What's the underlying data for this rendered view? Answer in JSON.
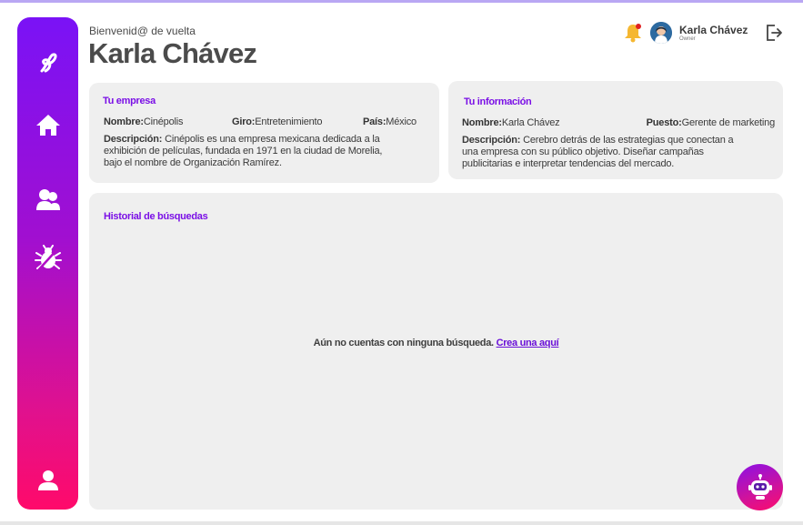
{
  "header": {
    "welcome": "Bienvenid@ de vuelta",
    "title": "Karla Chávez"
  },
  "user": {
    "name": "Karla Chávez",
    "role": "Owner",
    "notifications_indicator": true
  },
  "sidebar": {
    "items": [
      {
        "icon": "logo-icon"
      },
      {
        "icon": "home-icon"
      },
      {
        "icon": "users-icon"
      },
      {
        "icon": "bug-icon"
      },
      {
        "icon": "profile-icon"
      }
    ]
  },
  "company": {
    "title": "Tu empresa",
    "name_label": "Nombre:",
    "name": "Cinépolis",
    "giro_label": "Giro:",
    "giro": "Entretenimiento",
    "pais_label": "País:",
    "pais": "México",
    "desc_label": "Descripción:",
    "desc_line1": " Cinépolis es una empresa mexicana dedicada a la",
    "desc_line2": "exhibición de películas, fundada en 1971 en la ciudad de Morelia,",
    "desc_line3": "bajo el nombre de Organización Ramírez."
  },
  "info": {
    "title": "Tu información",
    "name_label": "Nombre:",
    "name": "Karla Chávez",
    "puesto_label": "Puesto:",
    "puesto": "Gerente de marketing",
    "desc_label": "Descripción:",
    "desc_line1": " Cerebro detrás de las estrategias que conectan a",
    "desc_line2": "una empresa con su público objetivo. Diseñar campañas",
    "desc_line3": "publicitarias e interpretar tendencias del mercado."
  },
  "history": {
    "title": "Historial de búsquedas",
    "empty_text": "Aún no cuentas con ninguna búsqueda. ",
    "create_link": "Crea una aquí"
  },
  "colors": {
    "accent": "#7a0fe6",
    "gradient_top": "#7a12f6",
    "gradient_bottom": "#ff0a6a",
    "card_bg": "#efefef",
    "bell": "#f5b731"
  }
}
